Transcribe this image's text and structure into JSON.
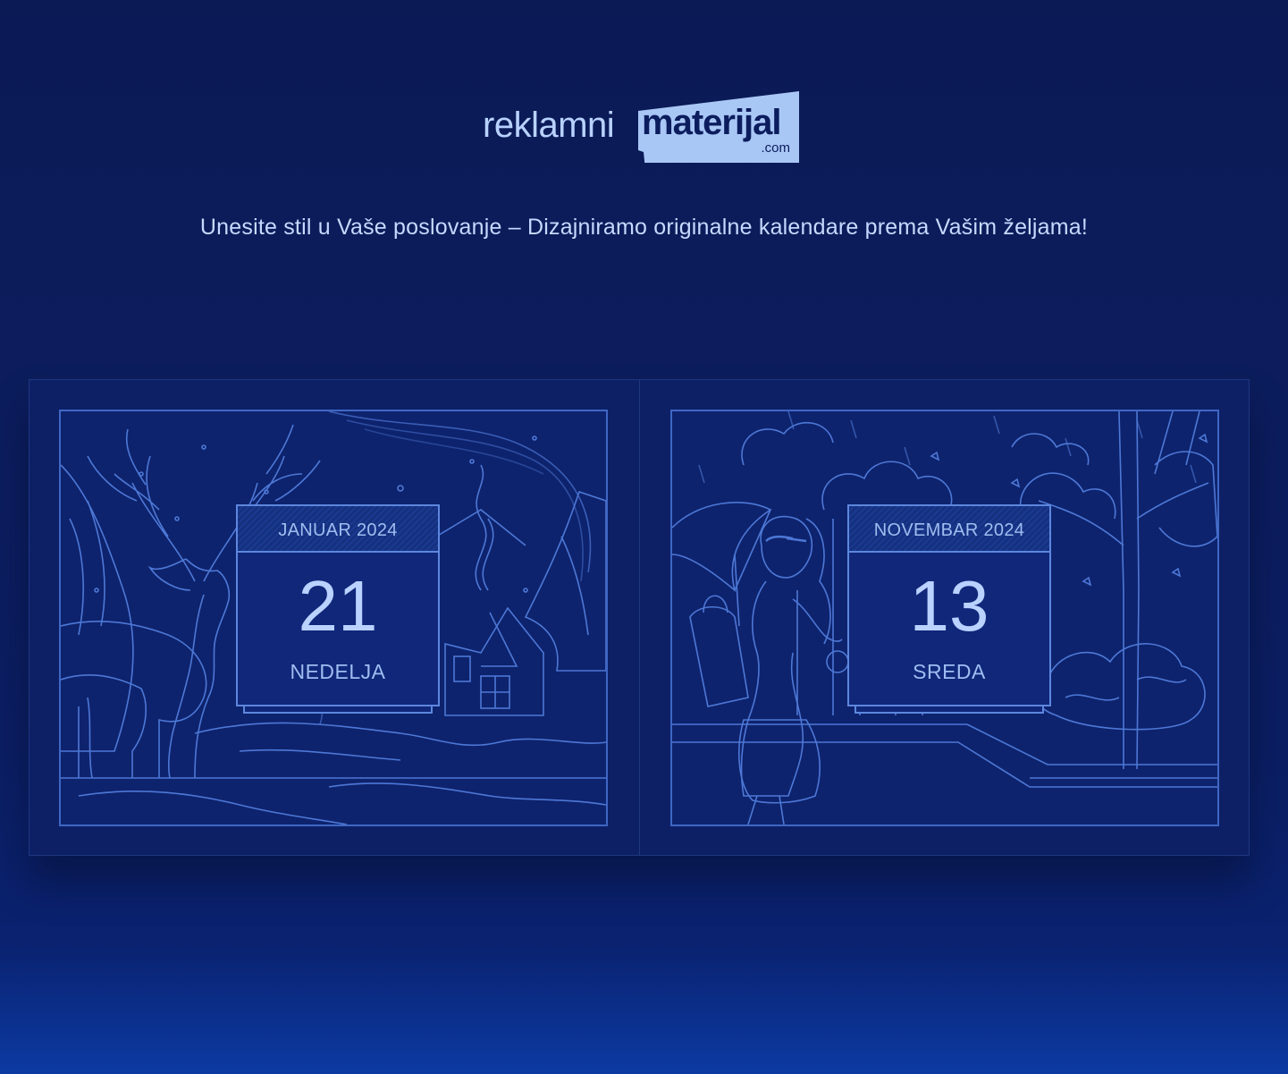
{
  "logo": {
    "light_text": "reklamni",
    "bold_text": "materijal",
    "suffix": ".com"
  },
  "tagline": "Unesite stil u Vaše poslovanje – Dizajniramo originalne kalendare prema Vašim željama!",
  "calendars": [
    {
      "month": "JANUAR 2024",
      "day": "21",
      "weekday": "NEDELJA",
      "scene": "winter-deer-cabin"
    },
    {
      "month": "NOVEMBAR 2024",
      "day": "13",
      "weekday": "SREDA",
      "scene": "autumn-woman-umbrella"
    }
  ],
  "colors": {
    "background": "#0c1d5e",
    "line_art": "#4d78d6",
    "text": "#c6d9ff",
    "logo_box": "#a9c7f5"
  }
}
